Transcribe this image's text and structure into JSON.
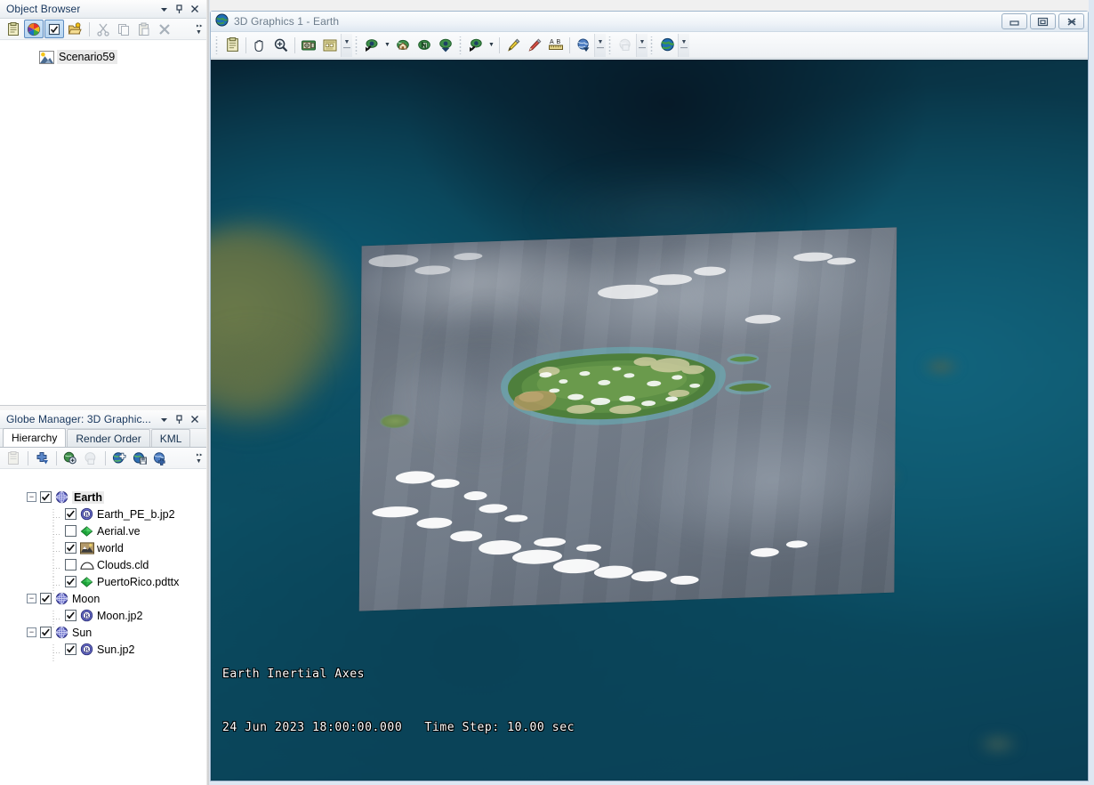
{
  "object_browser": {
    "title": "Object Browser",
    "titlebar_buttons": [
      {
        "name": "dropdown-menu-button",
        "glyph": "▼"
      },
      {
        "name": "auto-hide-pin-button",
        "glyph": "⟘"
      },
      {
        "name": "close-button",
        "glyph": "✕"
      }
    ],
    "toolbar": [
      {
        "name": "properties-button",
        "icon": "clipboard-icon",
        "active": false
      },
      {
        "name": "color-wheel-button",
        "icon": "color-wheel-icon",
        "active": true
      },
      {
        "name": "toggle-check-button",
        "icon": "checkbox-icon",
        "active": true
      },
      {
        "name": "new-object-button",
        "icon": "folder-star-icon",
        "active": false
      },
      {
        "name": "cut-button",
        "icon": "scissors-icon",
        "active": false
      },
      {
        "name": "copy-button",
        "icon": "copy-icon",
        "active": false
      },
      {
        "name": "paste-button",
        "icon": "paste-icon",
        "active": false
      },
      {
        "name": "delete-button",
        "icon": "x-delete-icon",
        "active": false
      },
      {
        "name": "toolbar-overflow-button",
        "icon": "chevron-overflow-icon",
        "active": false
      }
    ],
    "tree": [
      {
        "label": "Scenario59",
        "icon": "scenario-icon",
        "selected": true
      }
    ]
  },
  "globe_manager": {
    "title": "Globe Manager: 3D Graphic...",
    "titlebar_buttons": [
      {
        "name": "dropdown-menu-button",
        "glyph": "▼"
      },
      {
        "name": "auto-hide-pin-button",
        "glyph": "⟘"
      },
      {
        "name": "close-button",
        "glyph": "✕"
      }
    ],
    "tabs": [
      {
        "label": "Hierarchy",
        "selected": true
      },
      {
        "label": "Render Order",
        "selected": false
      },
      {
        "label": "KML",
        "selected": false
      }
    ],
    "toolbar": [
      {
        "name": "properties-button",
        "icon": "clipboard-disabled-icon",
        "disabled": true
      },
      {
        "name": "add-layer-button",
        "icon": "blue-plus-arrow-icon",
        "disabled": false
      },
      {
        "name": "zoom-to-layer-button",
        "icon": "globe-magnifier-icon",
        "disabled": false
      },
      {
        "name": "refresh-layer-button",
        "icon": "globe-refresh-disabled-icon",
        "disabled": true
      },
      {
        "name": "add-imagery-button",
        "icon": "globe-add-green-icon",
        "disabled": false
      },
      {
        "name": "save-globe-button",
        "icon": "globe-save-icon",
        "disabled": false
      },
      {
        "name": "add-terrain-button",
        "icon": "globe-add-blue-icon",
        "disabled": false
      },
      {
        "name": "toolbar-overflow-button",
        "icon": "chevron-overflow-icon",
        "disabled": false
      }
    ],
    "tree": [
      {
        "label": "Earth",
        "level": 0,
        "checked": true,
        "expander": "minus",
        "icon": "globe-central-body-icon",
        "bold": true
      },
      {
        "label": "Earth_PE_b.jp2",
        "level": 1,
        "checked": true,
        "expander": "none",
        "icon": "imagery-b-icon",
        "bold": false
      },
      {
        "label": "Aerial.ve",
        "level": 1,
        "checked": false,
        "expander": "none",
        "icon": "green-diamond-icon",
        "bold": false
      },
      {
        "label": "world",
        "level": 1,
        "checked": true,
        "expander": "none",
        "icon": "terrain-world-icon",
        "bold": false
      },
      {
        "label": "Clouds.cld",
        "level": 1,
        "checked": false,
        "expander": "none",
        "icon": "cloud-icon",
        "bold": false
      },
      {
        "label": "PuertoRico.pdttx",
        "level": 1,
        "checked": true,
        "expander": "none",
        "icon": "green-diamond-icon",
        "bold": false
      },
      {
        "label": "Moon",
        "level": 0,
        "checked": true,
        "expander": "minus",
        "icon": "globe-central-body-icon",
        "bold": false
      },
      {
        "label": "Moon.jp2",
        "level": 1,
        "checked": true,
        "expander": "none",
        "icon": "imagery-b-icon",
        "bold": false
      },
      {
        "label": "Sun",
        "level": 0,
        "checked": true,
        "expander": "minus",
        "icon": "globe-central-body-icon",
        "bold": false
      },
      {
        "label": "Sun.jp2",
        "level": 1,
        "checked": true,
        "expander": "none",
        "icon": "imagery-b-icon",
        "bold": false
      }
    ]
  },
  "graphics_window": {
    "title": "3D Graphics 1 - Earth",
    "title_icon": "globe-icon",
    "window_buttons": [
      {
        "name": "minimize-button",
        "glyph": "minimize"
      },
      {
        "name": "maximize-button",
        "glyph": "maximize"
      },
      {
        "name": "close-button",
        "glyph": "close"
      }
    ],
    "toolbar": [
      {
        "name": "properties-button",
        "icon": "clipboard-icon"
      },
      {
        "name": "pan-tool-button",
        "icon": "hand-icon"
      },
      {
        "name": "zoom-tool-button",
        "icon": "magnifier-plus-icon"
      },
      {
        "name": "snapshot-button",
        "icon": "camera-film-icon"
      },
      {
        "name": "record-movie-button",
        "icon": "movie-camera-icon"
      },
      {
        "name": "view-from-to-button",
        "icon": "eye-arrow-icon",
        "has_dropdown": true
      },
      {
        "name": "home-view-button",
        "icon": "eye-home-icon"
      },
      {
        "name": "north-view-button",
        "icon": "eye-north-icon"
      },
      {
        "name": "zoom-in-view-button",
        "icon": "eye-down-icon"
      },
      {
        "name": "view-target-button",
        "icon": "eye-target-icon",
        "has_dropdown": true
      },
      {
        "name": "highlight-tool-button",
        "icon": "paintbrush-icon"
      },
      {
        "name": "draw-tool-button",
        "icon": "pencil-icon"
      },
      {
        "name": "text-annotation-button",
        "icon": "ab-ruler-icon"
      },
      {
        "name": "globe-overlay-button",
        "icon": "globe-blue-down-icon",
        "has_dropdown": true
      },
      {
        "name": "globe-grid-button",
        "icon": "globe-gray-disabled-icon",
        "has_dropdown": true
      },
      {
        "name": "globe-earth-button",
        "icon": "globe-earth-icon",
        "has_dropdown": true
      }
    ],
    "hud": {
      "line1": "Earth Inertial Axes",
      "line2": "24 Jun 2023 18:00:00.000   Time Step: 10.00 sec",
      "epoch_date": "24 Jun 2023",
      "epoch_time": "18:00:00.000",
      "time_step_label": "Time Step:",
      "time_step_value": "10.00 sec",
      "reference_frame": "Earth Inertial Axes"
    },
    "scene": {
      "central_body": "Earth",
      "imagery_overlay": "PuertoRico.pdttx",
      "ocean_color": "#0c5068",
      "space_color": "#072434",
      "hud_text_color": "#ffffff"
    }
  }
}
